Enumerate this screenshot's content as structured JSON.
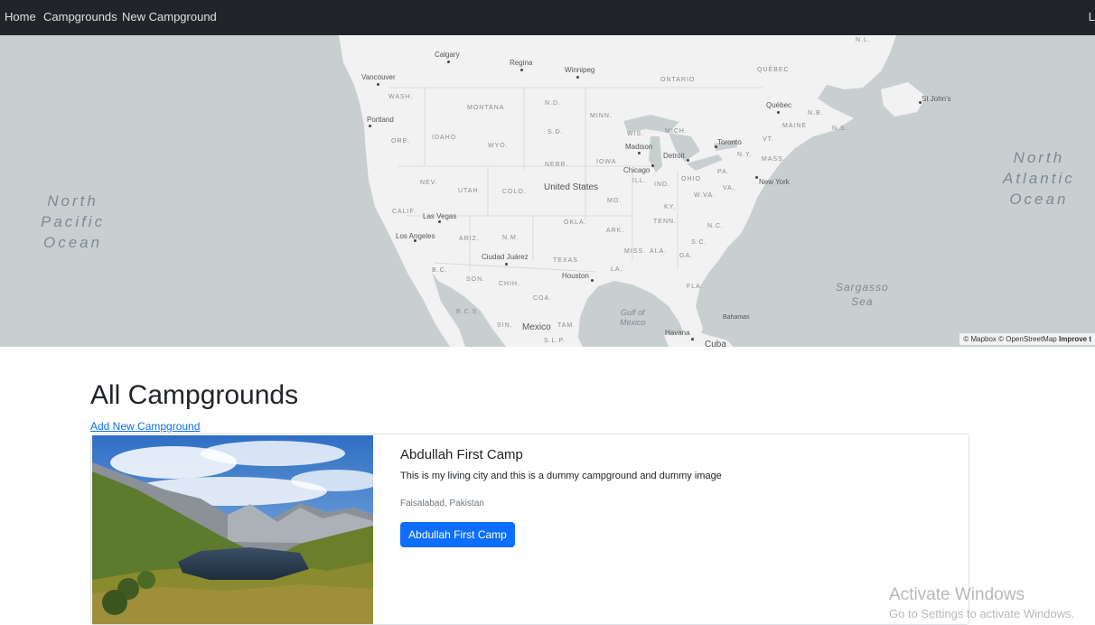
{
  "navbar": {
    "home_label": "Home",
    "campgrounds_label": "Campgrounds",
    "new_campground_label": "New Campground",
    "right_label": "L"
  },
  "map": {
    "ocean_labels": {
      "north_pacific": "North\nPacific\nOcean",
      "north_atlantic": "North\nAtlantic\nOcean",
      "sargasso": "Sargasso\nSea",
      "gulf": "Gulf of\nMexico"
    },
    "cities": {
      "calgary": "Calgary",
      "regina": "Regina",
      "winnipeg": "Winnipeg",
      "vancouver": "Vancouver",
      "portland": "Portland",
      "quebec": "Québec",
      "st_johns": "St John's",
      "madison": "Madison",
      "toronto": "Toronto",
      "detroit": "Detroit",
      "chicago": "Chicago",
      "new_york": "New York",
      "las_vegas": "Las Vegas",
      "los_angeles": "Los Angeles",
      "ciudad_juarez": "Ciudad Juárez",
      "houston": "Houston",
      "havana": "Havana",
      "bahamas": "Bahamas"
    },
    "regions": {
      "nl": "N.L.",
      "ontario": "ONTARIO",
      "quebec_prov": "QUÉBEC",
      "nb": "N.B.",
      "ns": "N.S.",
      "wash": "WASH.",
      "mont": "MONTANA",
      "nd": "N.D.",
      "minn": "MINN.",
      "ore": "ORE.",
      "idaho": "IDAHO",
      "wyo": "WYO.",
      "sd": "S.D.",
      "wis": "WIS.",
      "mich": "MICH.",
      "nebr": "NEBR.",
      "iowa": "IOWA",
      "nev": "NEV.",
      "utah": "UTAH",
      "colo": "COLO.",
      "ill": "ILL.",
      "ind": "IND.",
      "ohio": "OHIO",
      "pa": "PA.",
      "ny": "N.Y.",
      "vt": "VT.",
      "maine": "MAINE",
      "mass": "MASS.",
      "calif": "CALIF.",
      "mo": "MO.",
      "wva": "W.VA.",
      "ky": "KY.",
      "va": "VA.",
      "ariz": "ARIZ.",
      "nm": "N.M.",
      "okla": "OKLA.",
      "ark": "ARK.",
      "tenn": "TENN.",
      "nc": "N.C.",
      "sc": "S.C.",
      "miss": "MISS.",
      "ala": "ALA.",
      "ga": "GA.",
      "texas": "TEXAS",
      "la": "LA.",
      "fla": "FLA.",
      "bc": "B.C.",
      "son": "SON.",
      "chih": "CHIH.",
      "coa": "COA.",
      "bcs": "B.C.S.",
      "sin": "SIN.",
      "tam": "TAM.",
      "slp": "S.L.P."
    },
    "countries": {
      "us": "United States",
      "mexico": "Mexico",
      "cuba": "Cuba"
    },
    "attribution": "© Mapbox © OpenStreetMap",
    "improve": "Improve t"
  },
  "main": {
    "title": "All Campgrounds",
    "add_link": "Add New Campground"
  },
  "campgrounds": [
    {
      "title": "Abdullah First Camp",
      "description": "This is my living city and this is a dummy campground and dummy image",
      "location": "Faisalabad, Pakistan",
      "button_label": "Abdullah First Camp"
    }
  ],
  "watermark": {
    "line1": "Activate Windows",
    "line2": "Go to Settings to activate Windows."
  },
  "colors": {
    "navbar_bg": "#212529",
    "primary": "#0d6efd",
    "map_water": "#c9cfd1",
    "map_land": "#f2f2f2"
  }
}
